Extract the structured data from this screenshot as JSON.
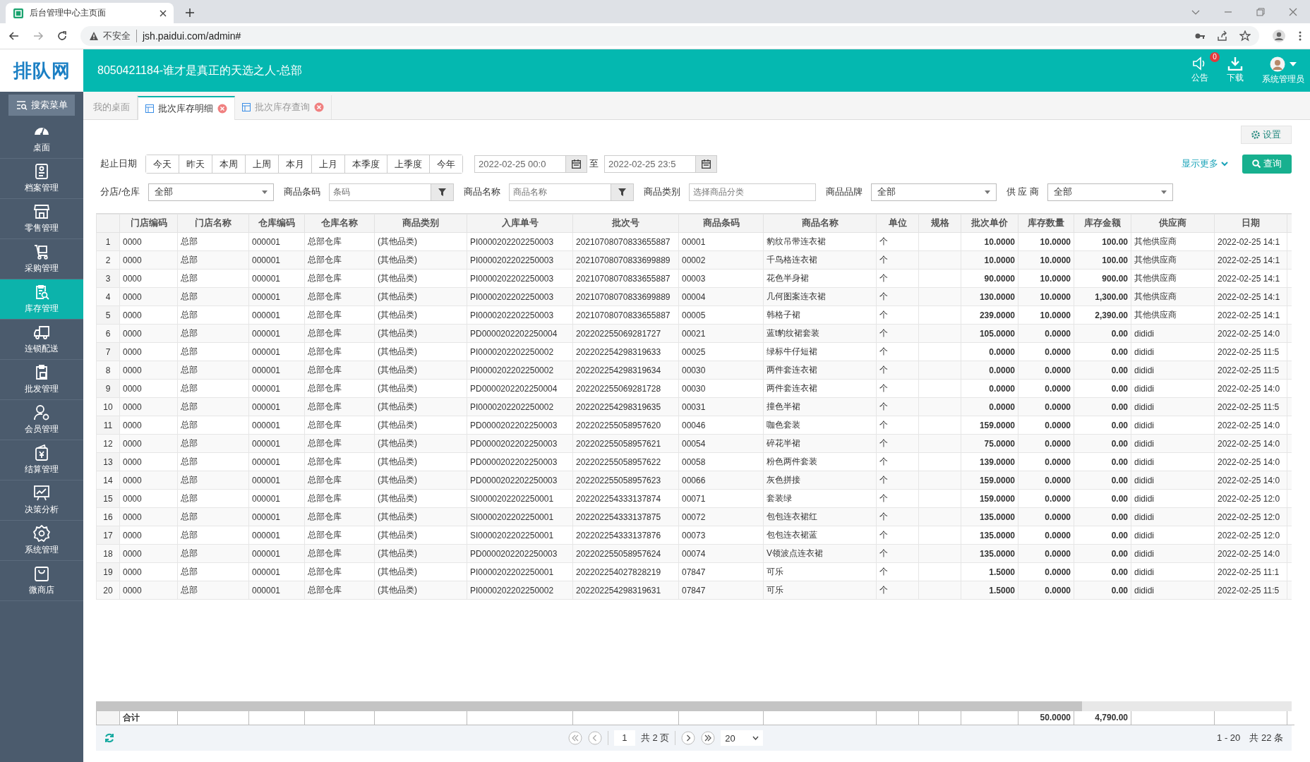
{
  "browser": {
    "tab_title": "后台管理中心主页面",
    "security_label": "不安全",
    "url": "jsh.paidui.com/admin#"
  },
  "header": {
    "logo": "排队网",
    "title": "8050421184-谁才是真正的天选之人-总部",
    "notice_label": "公告",
    "notice_badge": "0",
    "download_label": "下载",
    "user_label": "系统管理员"
  },
  "sidebar": {
    "search_button": "搜索菜单",
    "items": [
      {
        "label": "桌面",
        "selected": false
      },
      {
        "label": "档案管理",
        "selected": false
      },
      {
        "label": "零售管理",
        "selected": false
      },
      {
        "label": "采购管理",
        "selected": false
      },
      {
        "label": "库存管理",
        "selected": true
      },
      {
        "label": "连锁配送",
        "selected": false
      },
      {
        "label": "批发管理",
        "selected": false
      },
      {
        "label": "会员管理",
        "selected": false
      },
      {
        "label": "结算管理",
        "selected": false
      },
      {
        "label": "决策分析",
        "selected": false
      },
      {
        "label": "系统管理",
        "selected": false
      },
      {
        "label": "微商店",
        "selected": false
      }
    ]
  },
  "tabs": [
    {
      "label": "我的桌面",
      "selected": false,
      "closable": false
    },
    {
      "label": "批次库存明细",
      "selected": true,
      "closable": true
    },
    {
      "label": "批次库存查询",
      "selected": false,
      "closable": true
    }
  ],
  "settings_button": "设置",
  "filters": {
    "date_label": "起止日期",
    "quick_ranges": [
      "今天",
      "昨天",
      "本周",
      "上周",
      "本月",
      "上月",
      "本季度",
      "上季度",
      "今年"
    ],
    "date_from": "2022-02-25 00:0",
    "date_separator": "至",
    "date_to": "2022-02-25 23:5",
    "show_more": "显示更多",
    "query_button": "查询",
    "fields": [
      {
        "label": "分店/仓库",
        "kind": "select",
        "value": "全部"
      },
      {
        "label": "商品条码",
        "kind": "filter",
        "placeholder": "条码"
      },
      {
        "label": "商品名称",
        "kind": "filter",
        "placeholder": "商品名称"
      },
      {
        "label": "商品类别",
        "kind": "input",
        "placeholder": "选择商品分类"
      },
      {
        "label": "商品品牌",
        "kind": "select",
        "value": "全部"
      },
      {
        "label": "供 应 商",
        "kind": "select",
        "value": "全部"
      }
    ]
  },
  "table": {
    "columns": [
      {
        "title": "门店编码",
        "kind": "text"
      },
      {
        "title": "门店名称",
        "kind": "text"
      },
      {
        "title": "仓库编码",
        "kind": "text"
      },
      {
        "title": "仓库名称",
        "kind": "text"
      },
      {
        "title": "商品类别",
        "kind": "text"
      },
      {
        "title": "入库单号",
        "kind": "text"
      },
      {
        "title": "批次号",
        "kind": "text"
      },
      {
        "title": "商品条码",
        "kind": "text"
      },
      {
        "title": "商品名称",
        "kind": "text"
      },
      {
        "title": "单位",
        "kind": "text"
      },
      {
        "title": "规格",
        "kind": "text"
      },
      {
        "title": "批次单价",
        "kind": "number"
      },
      {
        "title": "库存数量",
        "kind": "number",
        "total": "50.0000"
      },
      {
        "title": "库存金额",
        "kind": "number",
        "total": "4,790.00"
      },
      {
        "title": "供应商",
        "kind": "text"
      },
      {
        "title": "日期",
        "kind": "text"
      }
    ],
    "rows": [
      {
        "no": "1",
        "cells": [
          "0000",
          "总部",
          "000001",
          "总部仓库",
          "(其他品类)",
          "PI0000202202250003",
          "20210708070833655887",
          "00001",
          "豹纹吊带连衣裙",
          "个",
          "",
          "10.0000",
          "10.0000",
          "100.00",
          "其他供应商",
          "2022-02-25 14:1"
        ]
      },
      {
        "no": "2",
        "cells": [
          "0000",
          "总部",
          "000001",
          "总部仓库",
          "(其他品类)",
          "PI0000202202250003",
          "20210708070833699889",
          "00002",
          "千鸟格连衣裙",
          "个",
          "",
          "10.0000",
          "10.0000",
          "100.00",
          "其他供应商",
          "2022-02-25 14:1"
        ]
      },
      {
        "no": "3",
        "cells": [
          "0000",
          "总部",
          "000001",
          "总部仓库",
          "(其他品类)",
          "PI0000202202250003",
          "20210708070833655887",
          "00003",
          "花色半身裙",
          "个",
          "",
          "90.0000",
          "10.0000",
          "900.00",
          "其他供应商",
          "2022-02-25 14:1"
        ]
      },
      {
        "no": "4",
        "cells": [
          "0000",
          "总部",
          "000001",
          "总部仓库",
          "(其他品类)",
          "PI0000202202250003",
          "20210708070833699889",
          "00004",
          "几何图案连衣裙",
          "个",
          "",
          "130.0000",
          "10.0000",
          "1,300.00",
          "其他供应商",
          "2022-02-25 14:1"
        ]
      },
      {
        "no": "5",
        "cells": [
          "0000",
          "总部",
          "000001",
          "总部仓库",
          "(其他品类)",
          "PI0000202202250003",
          "20210708070833655887",
          "00005",
          "韩格子裙",
          "个",
          "",
          "239.0000",
          "10.0000",
          "2,390.00",
          "其他供应商",
          "2022-02-25 14:1"
        ]
      },
      {
        "no": "6",
        "cells": [
          "0000",
          "总部",
          "000001",
          "总部仓库",
          "(其他品类)",
          "PD0000202202250004",
          "202202255069281727",
          "00021",
          "蓝t豹纹裙套装",
          "个",
          "",
          "105.0000",
          "0.0000",
          "0.00",
          "dididi",
          "2022-02-25 14:0"
        ]
      },
      {
        "no": "7",
        "cells": [
          "0000",
          "总部",
          "000001",
          "总部仓库",
          "(其他品类)",
          "PI0000202202250002",
          "202202254298319633",
          "00025",
          "绿标牛仔短裙",
          "个",
          "",
          "0.0000",
          "0.0000",
          "0.00",
          "dididi",
          "2022-02-25 11:5"
        ]
      },
      {
        "no": "8",
        "cells": [
          "0000",
          "总部",
          "000001",
          "总部仓库",
          "(其他品类)",
          "PI0000202202250002",
          "202202254298319634",
          "00030",
          "两件套连衣裙",
          "个",
          "",
          "0.0000",
          "0.0000",
          "0.00",
          "dididi",
          "2022-02-25 11:5"
        ]
      },
      {
        "no": "9",
        "cells": [
          "0000",
          "总部",
          "000001",
          "总部仓库",
          "(其他品类)",
          "PD0000202202250004",
          "202202255069281728",
          "00030",
          "两件套连衣裙",
          "个",
          "",
          "0.0000",
          "0.0000",
          "0.00",
          "dididi",
          "2022-02-25 14:0"
        ]
      },
      {
        "no": "10",
        "cells": [
          "0000",
          "总部",
          "000001",
          "总部仓库",
          "(其他品类)",
          "PI0000202202250002",
          "202202254298319635",
          "00031",
          "撞色半裙",
          "个",
          "",
          "0.0000",
          "0.0000",
          "0.00",
          "dididi",
          "2022-02-25 11:5"
        ]
      },
      {
        "no": "11",
        "cells": [
          "0000",
          "总部",
          "000001",
          "总部仓库",
          "(其他品类)",
          "PD0000202202250003",
          "202202255058957620",
          "00046",
          "咖色套装",
          "个",
          "",
          "159.0000",
          "0.0000",
          "0.00",
          "dididi",
          "2022-02-25 14:0"
        ]
      },
      {
        "no": "12",
        "cells": [
          "0000",
          "总部",
          "000001",
          "总部仓库",
          "(其他品类)",
          "PD0000202202250003",
          "202202255058957621",
          "00054",
          "碎花半裙",
          "个",
          "",
          "75.0000",
          "0.0000",
          "0.00",
          "dididi",
          "2022-02-25 14:0"
        ]
      },
      {
        "no": "13",
        "cells": [
          "0000",
          "总部",
          "000001",
          "总部仓库",
          "(其他品类)",
          "PD0000202202250003",
          "202202255058957622",
          "00058",
          "粉色两件套装",
          "个",
          "",
          "139.0000",
          "0.0000",
          "0.00",
          "dididi",
          "2022-02-25 14:0"
        ]
      },
      {
        "no": "14",
        "cells": [
          "0000",
          "总部",
          "000001",
          "总部仓库",
          "(其他品类)",
          "PD0000202202250003",
          "202202255058957623",
          "00066",
          "灰色拼接",
          "个",
          "",
          "159.0000",
          "0.0000",
          "0.00",
          "dididi",
          "2022-02-25 14:0"
        ]
      },
      {
        "no": "15",
        "cells": [
          "0000",
          "总部",
          "000001",
          "总部仓库",
          "(其他品类)",
          "SI0000202202250001",
          "202202254333137874",
          "00071",
          "套装绿",
          "个",
          "",
          "159.0000",
          "0.0000",
          "0.00",
          "dididi",
          "2022-02-25 12:0"
        ]
      },
      {
        "no": "16",
        "cells": [
          "0000",
          "总部",
          "000001",
          "总部仓库",
          "(其他品类)",
          "SI0000202202250001",
          "202202254333137875",
          "00072",
          "包包连衣裙红",
          "个",
          "",
          "135.0000",
          "0.0000",
          "0.00",
          "dididi",
          "2022-02-25 12:0"
        ]
      },
      {
        "no": "17",
        "cells": [
          "0000",
          "总部",
          "000001",
          "总部仓库",
          "(其他品类)",
          "SI0000202202250001",
          "202202254333137876",
          "00073",
          "包包连衣裙蓝",
          "个",
          "",
          "135.0000",
          "0.0000",
          "0.00",
          "dididi",
          "2022-02-25 12:0"
        ]
      },
      {
        "no": "18",
        "cells": [
          "0000",
          "总部",
          "000001",
          "总部仓库",
          "(其他品类)",
          "PD0000202202250003",
          "202202255058957624",
          "00074",
          "V领波点连衣裙",
          "个",
          "",
          "135.0000",
          "0.0000",
          "0.00",
          "dididi",
          "2022-02-25 14:0"
        ]
      },
      {
        "no": "19",
        "cells": [
          "0000",
          "总部",
          "000001",
          "总部仓库",
          "(其他品类)",
          "PI0000202202250001",
          "202202254027828219",
          "07847",
          "可乐",
          "个",
          "",
          "1.5000",
          "0.0000",
          "0.00",
          "dididi",
          "2022-02-25 11:1"
        ]
      },
      {
        "no": "20",
        "cells": [
          "0000",
          "总部",
          "000001",
          "总部仓库",
          "(其他品类)",
          "PI0000202202250002",
          "202202254298319631",
          "07847",
          "可乐",
          "个",
          "",
          "1.5000",
          "0.0000",
          "0.00",
          "dididi",
          "2022-02-25 11:5"
        ]
      }
    ],
    "totals_label": "合计"
  },
  "pager": {
    "page": "1",
    "page_count": "共 2 页",
    "page_size": "20",
    "summary": "1 - 20　共 22 条"
  }
}
